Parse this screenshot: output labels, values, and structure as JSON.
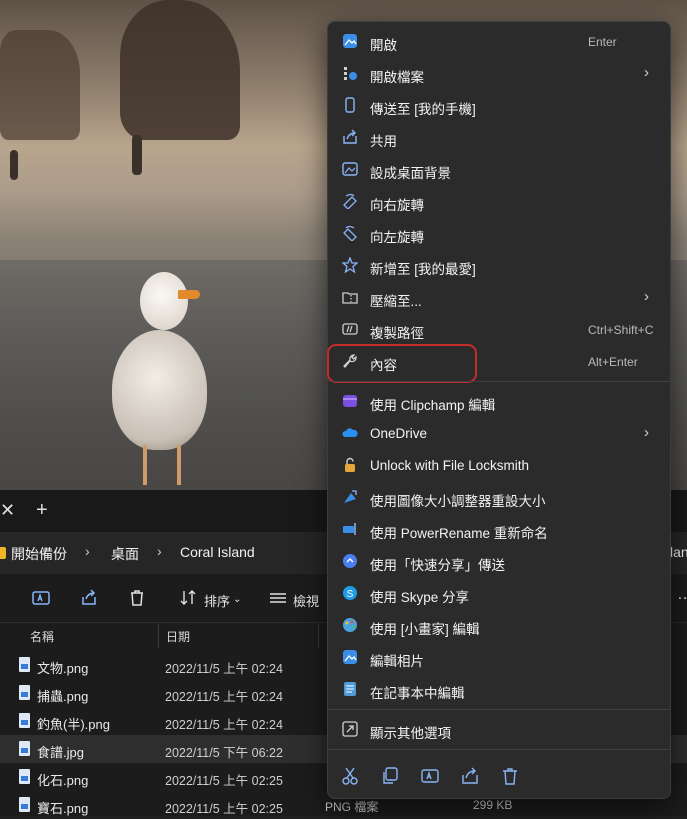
{
  "explorer": {
    "breadcrumbs": [
      "開始備份",
      "桌面",
      "Coral Island"
    ],
    "breadcrumb_overflow": "lan",
    "toolbar": {
      "sort_label": "排序",
      "view_label": "檢視"
    },
    "columns": {
      "name": "名稱",
      "date": "日期"
    },
    "files": [
      {
        "name": "文物.png",
        "date": "2022/11/5 上午 02:24",
        "type": "",
        "size": ""
      },
      {
        "name": "捕蟲.png",
        "date": "2022/11/5 上午 02:24",
        "type": "",
        "size": ""
      },
      {
        "name": "釣魚(半).png",
        "date": "2022/11/5 上午 02:24",
        "type": "",
        "size": ""
      },
      {
        "name": "食譜.jpg",
        "date": "2022/11/5 下午 06:22",
        "type": "",
        "size": ""
      },
      {
        "name": "化石.png",
        "date": "2022/11/5 上午 02:25",
        "type": "",
        "size": ""
      },
      {
        "name": "寶石.png",
        "date": "2022/11/5 上午 02:25",
        "type": "PNG 檔案",
        "size": "299 KB"
      }
    ]
  },
  "menu": {
    "items": [
      {
        "label": "開啟",
        "shortcut": "Enter",
        "icon": "photos-icon"
      },
      {
        "label": "開啟檔案",
        "icon": "open-with-icon",
        "submenu": true
      },
      {
        "label": "傳送至 [我的手機]",
        "icon": "phone-icon"
      },
      {
        "label": "共用",
        "icon": "share-icon"
      },
      {
        "label": "設成桌面背景",
        "icon": "wallpaper-icon"
      },
      {
        "label": "向右旋轉",
        "icon": "rotate-right-icon"
      },
      {
        "label": "向左旋轉",
        "icon": "rotate-left-icon"
      },
      {
        "label": "新增至 [我的最愛]",
        "icon": "star-icon"
      },
      {
        "label": "壓縮至...",
        "icon": "zip-folder-icon",
        "submenu": true
      },
      {
        "label": "複製路徑",
        "shortcut": "Ctrl+Shift+C",
        "icon": "copy-path-icon"
      },
      {
        "label": "內容",
        "shortcut": "Alt+Enter",
        "icon": "wrench-icon"
      },
      {
        "label": "使用 Clipchamp 編輯",
        "icon": "clipchamp-icon"
      },
      {
        "label": "OneDrive",
        "icon": "cloud-icon",
        "submenu": true
      },
      {
        "label": "Unlock with File Locksmith",
        "icon": "lock-icon"
      },
      {
        "label": "使用圖像大小調整器重設大小",
        "icon": "image-resizer-icon"
      },
      {
        "label": "使用 PowerRename 重新命名",
        "icon": "powerrename-icon"
      },
      {
        "label": "使用「快速分享」傳送",
        "icon": "quick-share-icon"
      },
      {
        "label": "使用 Skype 分享",
        "icon": "skype-icon"
      },
      {
        "label": "使用 [小畫家] 編輯",
        "icon": "paint-icon"
      },
      {
        "label": "編輯相片",
        "icon": "edit-photo-icon"
      },
      {
        "label": "在記事本中編輯",
        "icon": "notepad-icon"
      },
      {
        "label": "顯示其他選項",
        "icon": "more-options-icon"
      }
    ],
    "bottom_actions": [
      "cut-icon",
      "copy-icon",
      "rename-icon",
      "share-icon",
      "delete-icon"
    ],
    "highlight_color": "#c42b2b"
  }
}
